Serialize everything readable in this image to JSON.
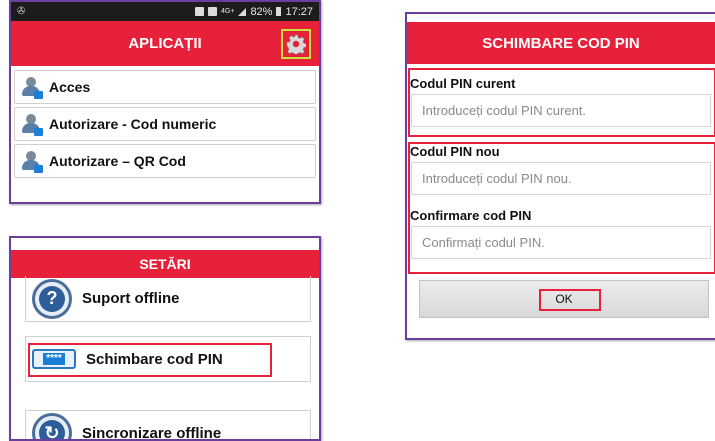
{
  "apps_screen": {
    "status_time": "17:27",
    "status_battery": "82%",
    "status_network": "4G+",
    "title": "APLICAȚII",
    "items": [
      {
        "label": "Acces"
      },
      {
        "label": "Autorizare - Cod numeric"
      },
      {
        "label": "Autorizare – QR Cod"
      }
    ]
  },
  "settings_screen": {
    "title": "SETĂRI",
    "items": [
      {
        "label": "Suport offline"
      },
      {
        "label": "Schimbare cod PIN"
      },
      {
        "label": "Sincronizare offline"
      }
    ],
    "pin_icon_text": "****"
  },
  "pin_screen": {
    "title": "SCHIMBARE COD PIN",
    "current_label": "Codul PIN curent",
    "current_placeholder": "Introduceți codul PIN curent.",
    "new_label": "Codul PIN nou",
    "new_placeholder": "Introduceți codul PIN nou.",
    "confirm_label": "Confirmare cod PIN",
    "confirm_placeholder": "Confirmați codul PIN.",
    "ok_label": "OK"
  },
  "colors": {
    "header_red": "#e8213a",
    "highlight_red": "#e8213a",
    "gear_highlight": "#c9e33a",
    "frame_purple": "#6b3fa0"
  }
}
